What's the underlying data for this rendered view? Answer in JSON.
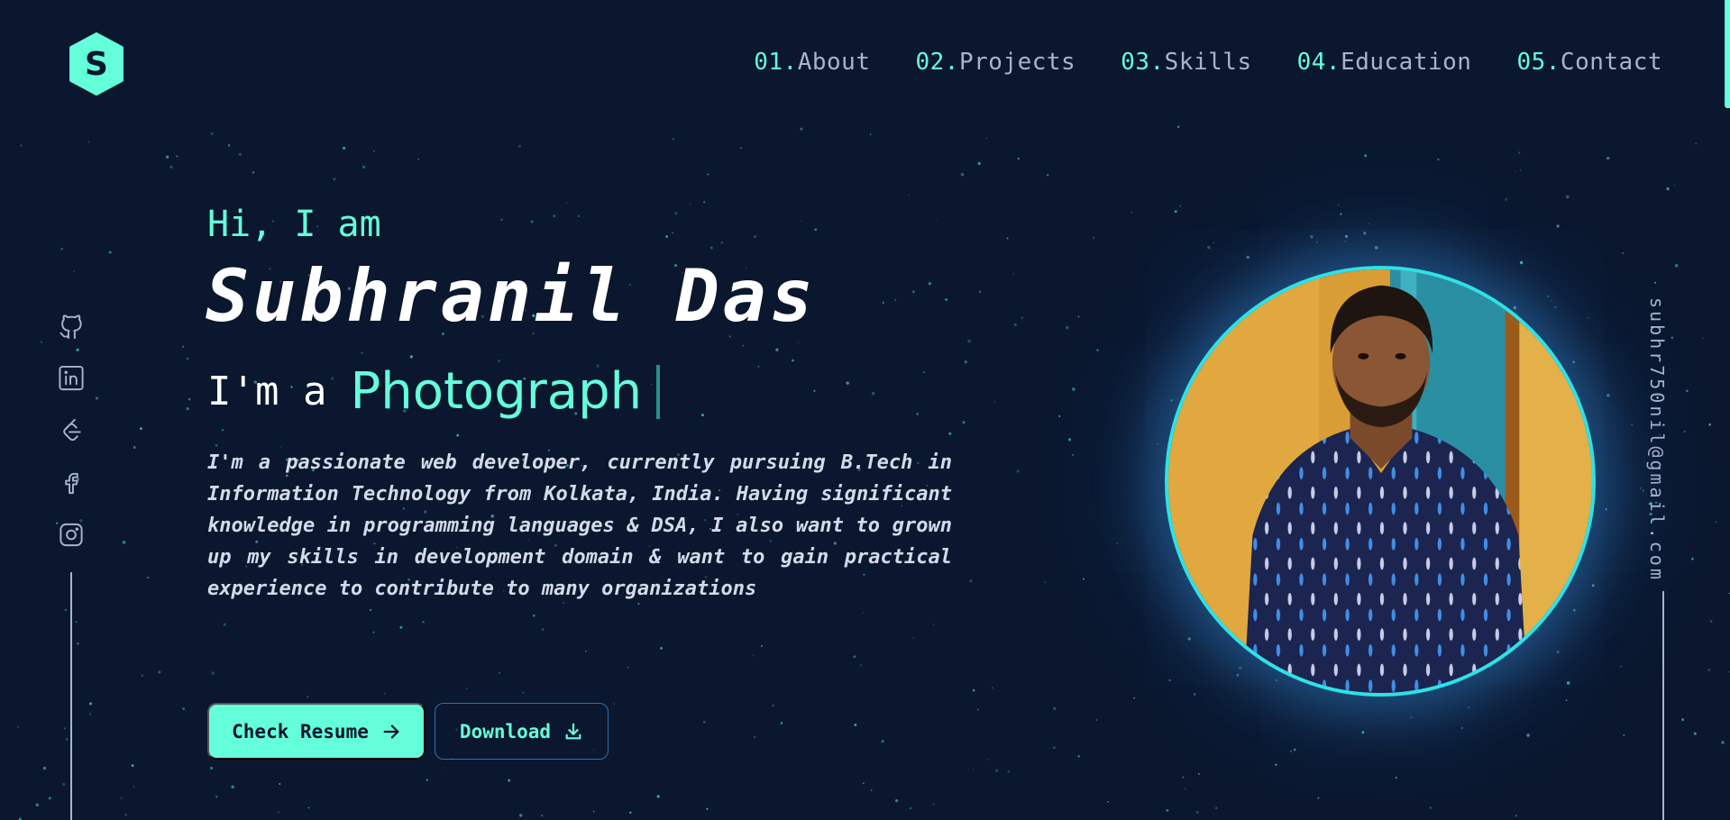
{
  "header": {
    "logo_letter": "S",
    "nav": [
      {
        "num": "01.",
        "label": "About"
      },
      {
        "num": "02.",
        "label": "Projects"
      },
      {
        "num": "03.",
        "label": "Skills"
      },
      {
        "num": "04.",
        "label": "Education"
      },
      {
        "num": "05.",
        "label": "Contact"
      }
    ]
  },
  "socials": [
    {
      "icon": "github-icon"
    },
    {
      "icon": "linkedin-icon"
    },
    {
      "icon": "leetcode-icon"
    },
    {
      "icon": "facebook-icon"
    },
    {
      "icon": "instagram-icon"
    }
  ],
  "email": "subhr750nil@gmail.com",
  "hero": {
    "greeting": "Hi, I am",
    "name": "Subhranil Das",
    "role_prefix": "I'm a",
    "role_word": "Photograph",
    "bio": "I'm a passionate web developer, currently pursuing B.Tech in Information Technology from Kolkata, India. Having significant knowledge in programming languages & DSA, I also want to grown up my skills in development domain & want to gain practical experience to contribute to many organizations",
    "resume_button": "Check Resume",
    "download_button": "Download"
  },
  "colors": {
    "background": "#0a172e",
    "accent": "#64ffda",
    "muted": "#a8b4cc"
  }
}
